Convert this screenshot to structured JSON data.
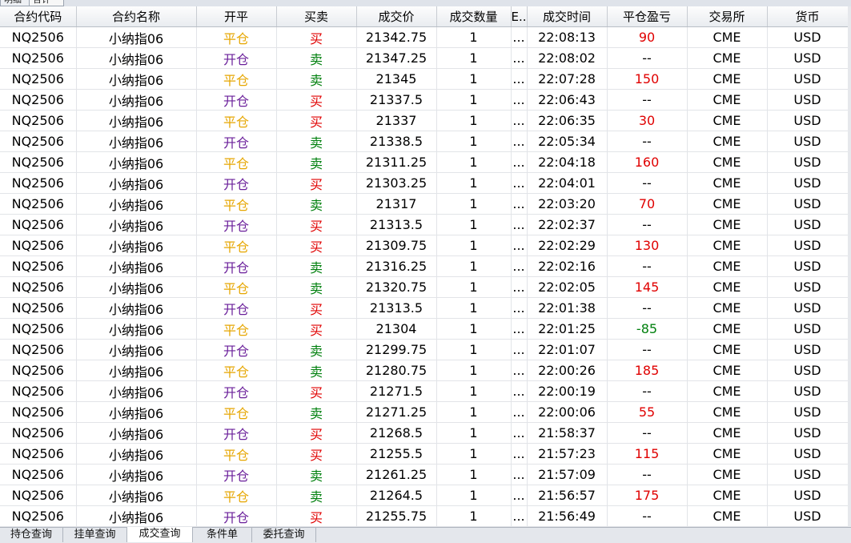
{
  "top_tabs": [
    "明细",
    "合计"
  ],
  "columns": [
    "合约代码",
    "合约名称",
    "开平",
    "买卖",
    "成交价",
    "成交数量",
    "E..",
    "成交时间",
    "平仓盈亏",
    "交易所",
    "货币"
  ],
  "colors": {
    "close_position": "#e6a600",
    "open_position": "#6a1f9a",
    "buy": "#e00000",
    "sell": "#00800e",
    "profit": "#e00000",
    "loss": "#00800e"
  },
  "rows": [
    [
      "NQ2506",
      "小纳指06",
      "平仓",
      "买",
      "21342.75",
      "1",
      "...",
      "22:08:13",
      "90",
      "CME",
      "USD"
    ],
    [
      "NQ2506",
      "小纳指06",
      "开仓",
      "卖",
      "21347.25",
      "1",
      "...",
      "22:08:02",
      "--",
      "CME",
      "USD"
    ],
    [
      "NQ2506",
      "小纳指06",
      "平仓",
      "卖",
      "21345",
      "1",
      "...",
      "22:07:28",
      "150",
      "CME",
      "USD"
    ],
    [
      "NQ2506",
      "小纳指06",
      "开仓",
      "买",
      "21337.5",
      "1",
      "...",
      "22:06:43",
      "--",
      "CME",
      "USD"
    ],
    [
      "NQ2506",
      "小纳指06",
      "平仓",
      "买",
      "21337",
      "1",
      "...",
      "22:06:35",
      "30",
      "CME",
      "USD"
    ],
    [
      "NQ2506",
      "小纳指06",
      "开仓",
      "卖",
      "21338.5",
      "1",
      "...",
      "22:05:34",
      "--",
      "CME",
      "USD"
    ],
    [
      "NQ2506",
      "小纳指06",
      "平仓",
      "卖",
      "21311.25",
      "1",
      "...",
      "22:04:18",
      "160",
      "CME",
      "USD"
    ],
    [
      "NQ2506",
      "小纳指06",
      "开仓",
      "买",
      "21303.25",
      "1",
      "...",
      "22:04:01",
      "--",
      "CME",
      "USD"
    ],
    [
      "NQ2506",
      "小纳指06",
      "平仓",
      "卖",
      "21317",
      "1",
      "...",
      "22:03:20",
      "70",
      "CME",
      "USD"
    ],
    [
      "NQ2506",
      "小纳指06",
      "开仓",
      "买",
      "21313.5",
      "1",
      "...",
      "22:02:37",
      "--",
      "CME",
      "USD"
    ],
    [
      "NQ2506",
      "小纳指06",
      "平仓",
      "买",
      "21309.75",
      "1",
      "...",
      "22:02:29",
      "130",
      "CME",
      "USD"
    ],
    [
      "NQ2506",
      "小纳指06",
      "开仓",
      "卖",
      "21316.25",
      "1",
      "...",
      "22:02:16",
      "--",
      "CME",
      "USD"
    ],
    [
      "NQ2506",
      "小纳指06",
      "平仓",
      "卖",
      "21320.75",
      "1",
      "...",
      "22:02:05",
      "145",
      "CME",
      "USD"
    ],
    [
      "NQ2506",
      "小纳指06",
      "开仓",
      "买",
      "21313.5",
      "1",
      "...",
      "22:01:38",
      "--",
      "CME",
      "USD"
    ],
    [
      "NQ2506",
      "小纳指06",
      "平仓",
      "买",
      "21304",
      "1",
      "...",
      "22:01:25",
      "-85",
      "CME",
      "USD"
    ],
    [
      "NQ2506",
      "小纳指06",
      "开仓",
      "卖",
      "21299.75",
      "1",
      "...",
      "22:01:07",
      "--",
      "CME",
      "USD"
    ],
    [
      "NQ2506",
      "小纳指06",
      "平仓",
      "卖",
      "21280.75",
      "1",
      "...",
      "22:00:26",
      "185",
      "CME",
      "USD"
    ],
    [
      "NQ2506",
      "小纳指06",
      "开仓",
      "买",
      "21271.5",
      "1",
      "...",
      "22:00:19",
      "--",
      "CME",
      "USD"
    ],
    [
      "NQ2506",
      "小纳指06",
      "平仓",
      "卖",
      "21271.25",
      "1",
      "...",
      "22:00:06",
      "55",
      "CME",
      "USD"
    ],
    [
      "NQ2506",
      "小纳指06",
      "开仓",
      "买",
      "21268.5",
      "1",
      "...",
      "21:58:37",
      "--",
      "CME",
      "USD"
    ],
    [
      "NQ2506",
      "小纳指06",
      "平仓",
      "买",
      "21255.5",
      "1",
      "...",
      "21:57:23",
      "115",
      "CME",
      "USD"
    ],
    [
      "NQ2506",
      "小纳指06",
      "开仓",
      "卖",
      "21261.25",
      "1",
      "...",
      "21:57:09",
      "--",
      "CME",
      "USD"
    ],
    [
      "NQ2506",
      "小纳指06",
      "平仓",
      "卖",
      "21264.5",
      "1",
      "...",
      "21:56:57",
      "175",
      "CME",
      "USD"
    ],
    [
      "NQ2506",
      "小纳指06",
      "开仓",
      "买",
      "21255.75",
      "1",
      "...",
      "21:56:49",
      "--",
      "CME",
      "USD"
    ]
  ],
  "bottom_tabs": [
    "持仓查询",
    "挂单查询",
    "成交查询",
    "条件单",
    "委托查询"
  ],
  "active_bottom_tab": "成交查询"
}
